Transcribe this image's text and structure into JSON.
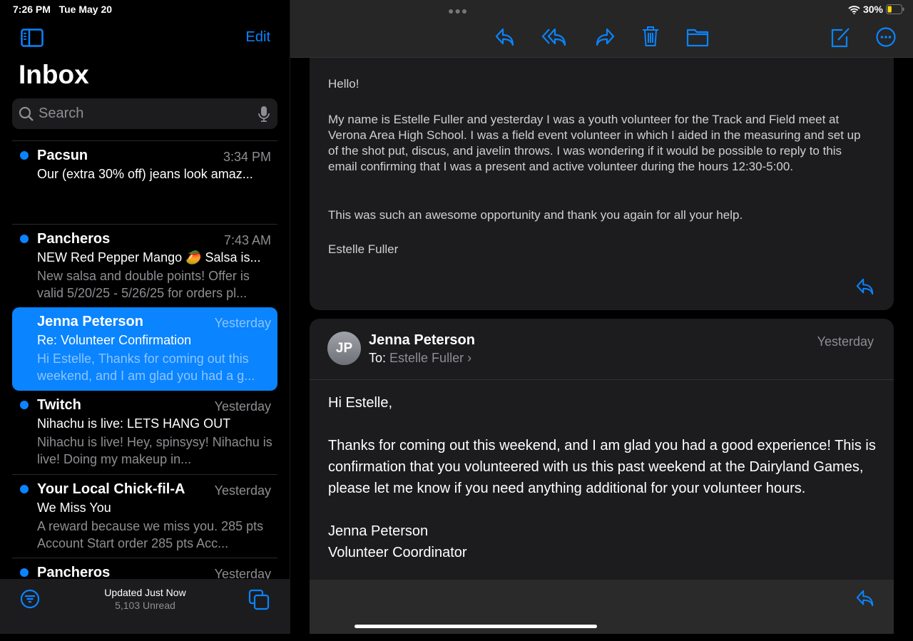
{
  "status": {
    "time": "7:26 PM",
    "date": "Tue May 20",
    "battery": "30%",
    "battery_level": 0.3
  },
  "sidebar": {
    "edit_label": "Edit",
    "title": "Inbox",
    "search_placeholder": "Search",
    "messages": [
      {
        "from": "Pacsun",
        "time": "3:34 PM",
        "subject": "Our (extra 30% off) jeans look amaz...",
        "preview": "",
        "unread": true
      },
      {
        "from": "Pancheros",
        "time": "7:43 AM",
        "subject": "NEW Red Pepper Mango 🥭 Salsa is...",
        "preview": "New salsa and double points! Offer is valid 5/20/25 - 5/26/25 for orders pl...",
        "unread": true
      },
      {
        "from": "Jenna Peterson",
        "time": "Yesterday",
        "subject": "Re: Volunteer Confirmation",
        "preview": "Hi Estelle, Thanks for coming out this weekend, and I am glad you had a g...",
        "unread": false
      },
      {
        "from": "Twitch",
        "time": "Yesterday",
        "subject": "Nihachu is live: LETS HANG OUT",
        "preview": "Nihachu is live! Hey, spinsysy! Nihachu is live! Doing my makeup in...",
        "unread": true
      },
      {
        "from": "Your Local Chick-fil-A",
        "time": "Yesterday",
        "subject": "We Miss You",
        "preview": "A reward because we miss you. 285 pts Account Start order 285 pts Acc...",
        "unread": true
      },
      {
        "from": "Pancheros",
        "time": "Yesterday",
        "subject": "",
        "preview": "",
        "unread": true
      }
    ],
    "updated": "Updated Just Now",
    "unread_count": "5,103 Unread"
  },
  "thread": {
    "quoted": {
      "greeting": "Hello!",
      "para1": "My name is Estelle Fuller and yesterday I was a youth volunteer for the Track and Field meet at Verona Area High School. I was a field event volunteer in which I aided in the measuring and set up of the shot put, discus, and javelin throws. I was wondering if it would be possible to reply to this email confirming that I was a present and active volunteer during the hours 12:30-5:00.",
      "para2": "This was such an awesome opportunity and thank you again for all your help.",
      "signature": "Estelle Fuller"
    },
    "reply": {
      "initials": "JP",
      "sender": "Jenna Peterson",
      "to_label": "To:",
      "to": "Estelle Fuller",
      "date": "Yesterday",
      "greeting": "Hi Estelle,",
      "body": "Thanks for coming out this weekend, and I am glad you had a good experience! This is confirmation that you volunteered with us this past weekend at the Dairyland Games, please let me know if you need anything additional for your volunteer hours.",
      "sig_name": "Jenna Peterson",
      "sig_title": "Volunteer Coordinator"
    }
  },
  "colors": {
    "accent": "#0a84ff",
    "battery": "#ffd60a"
  }
}
